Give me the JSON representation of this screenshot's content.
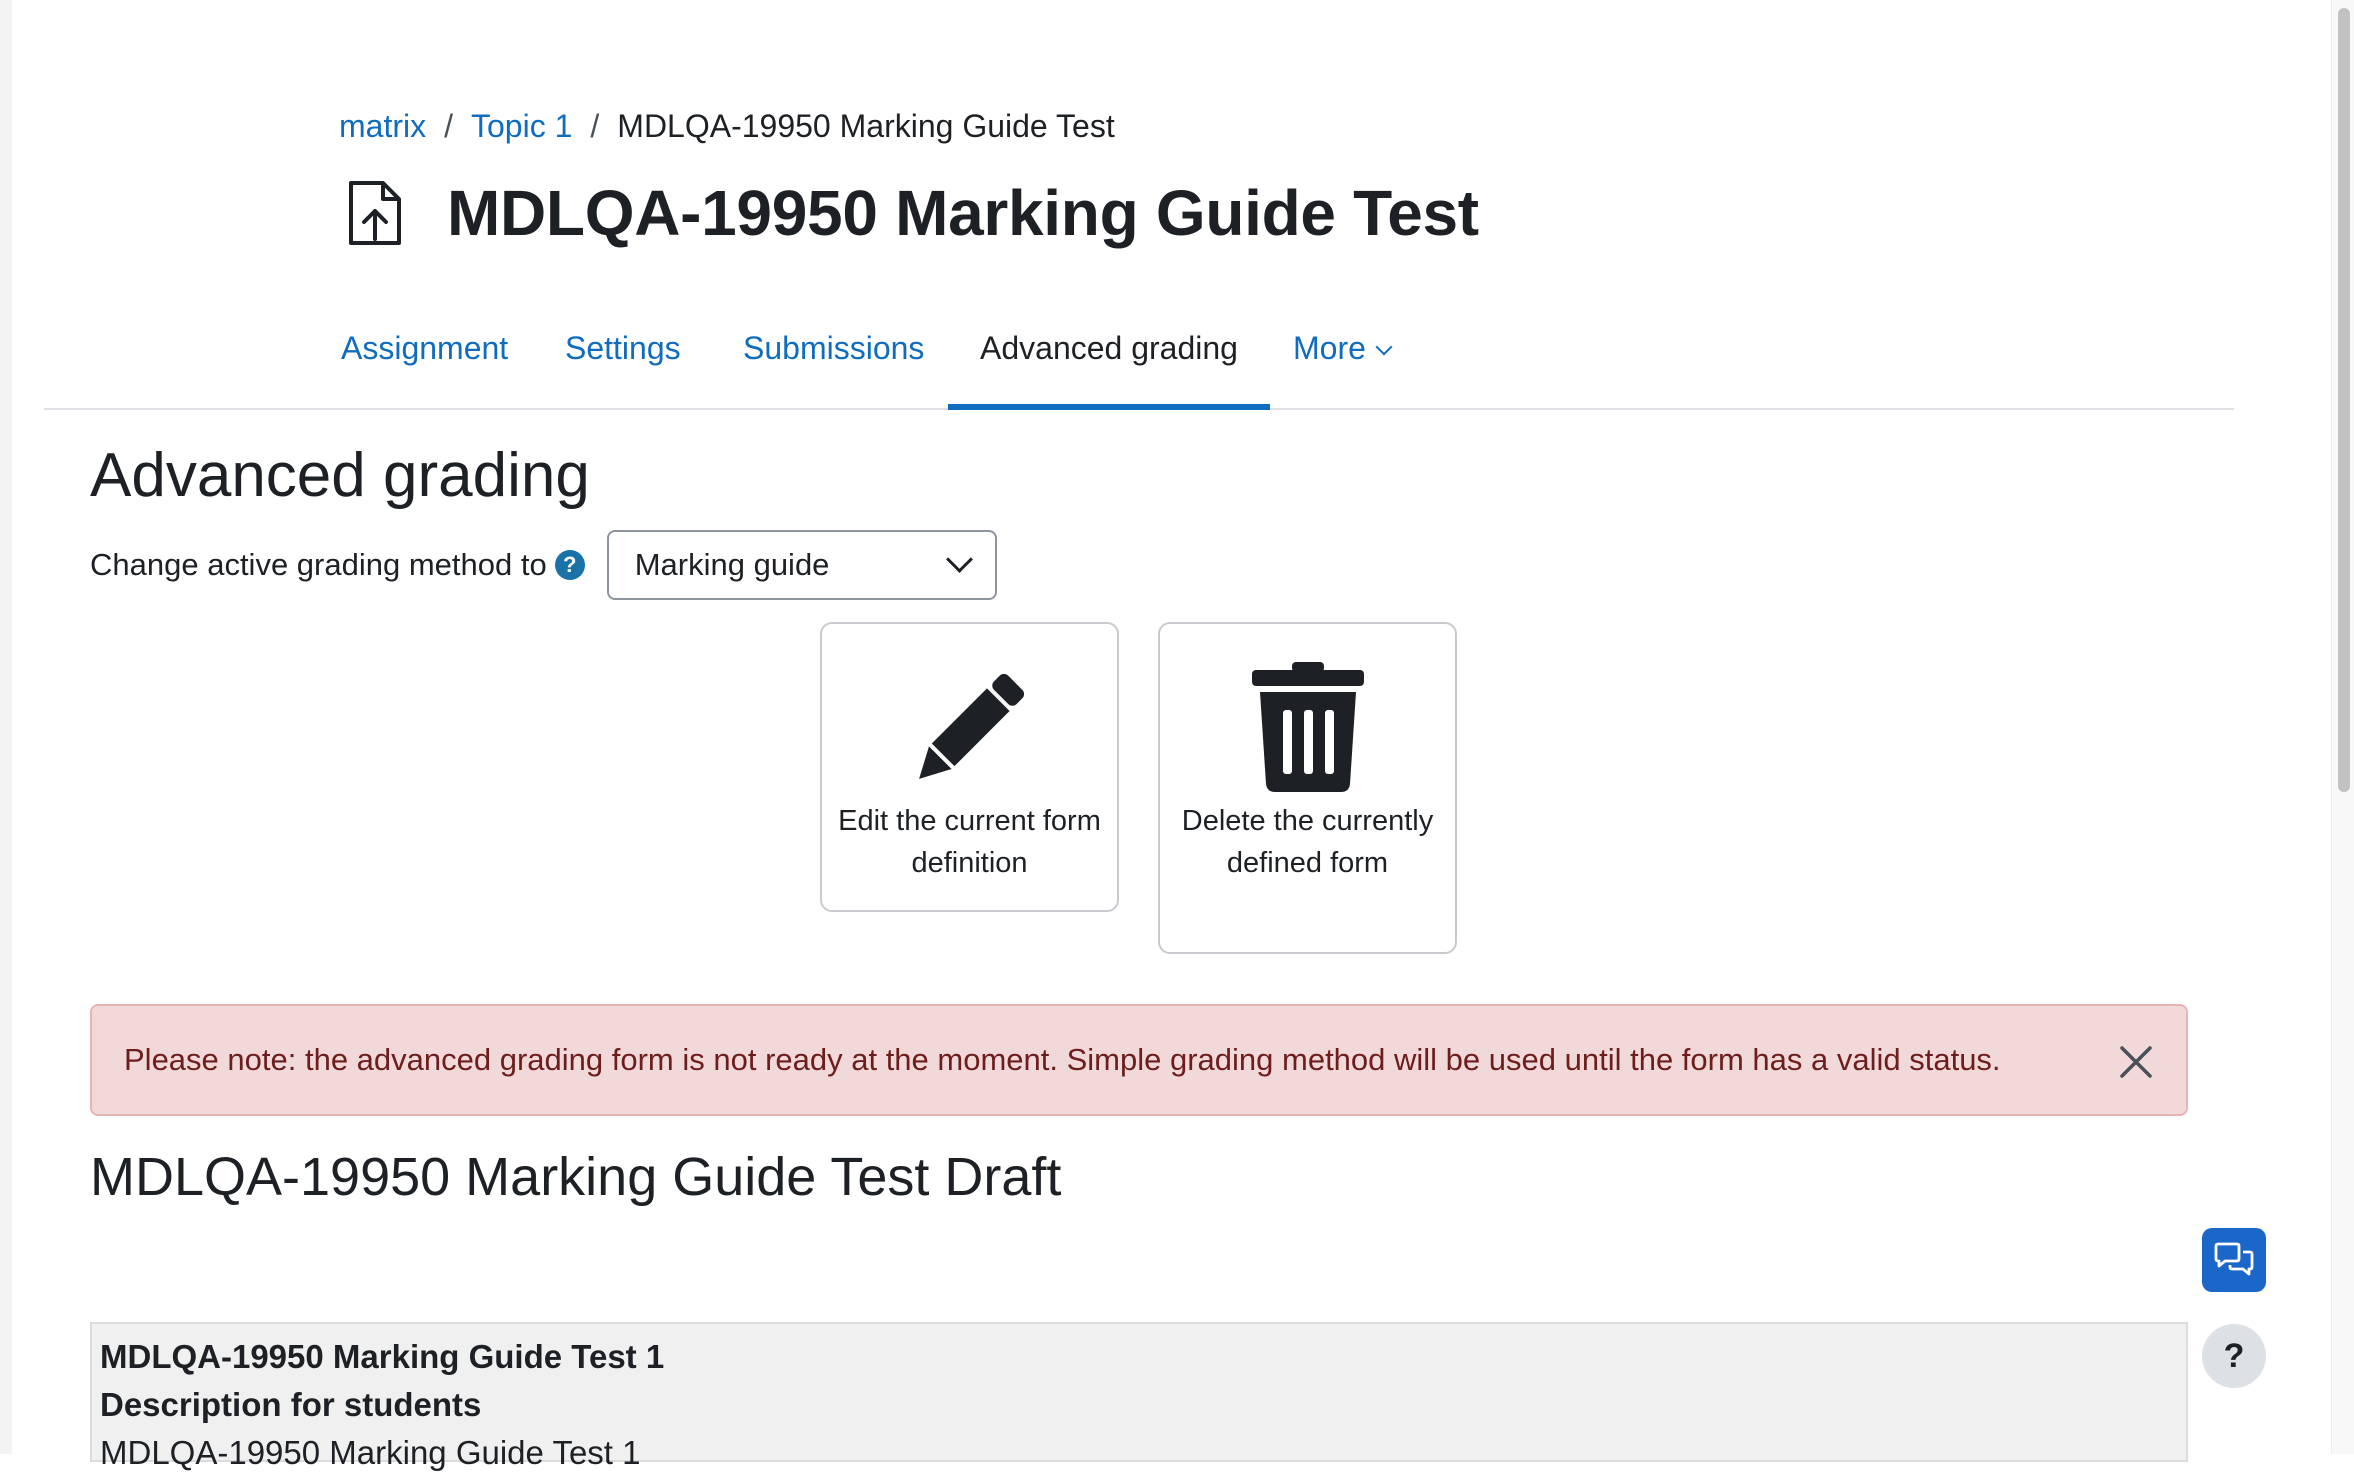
{
  "breadcrumb": {
    "items": [
      "matrix",
      "Topic 1"
    ],
    "current": "MDLQA-19950 Marking Guide Test",
    "separator": "/"
  },
  "page": {
    "title": "MDLQA-19950 Marking Guide Test",
    "icon": "file-upload-icon"
  },
  "tabs": [
    {
      "label": "Assignment"
    },
    {
      "label": "Settings"
    },
    {
      "label": "Submissions"
    },
    {
      "label": "Advanced grading",
      "active": true
    },
    {
      "label": "More"
    }
  ],
  "section": {
    "heading": "Advanced grading",
    "method_label": "Change active grading method to",
    "help_icon_glyph": "?",
    "method_selected": "Marking guide"
  },
  "actions": {
    "edit_label": "Edit the current form definition",
    "delete_label": "Delete the currently defined form",
    "edit_icon": "pencil-icon",
    "delete_icon": "trash-icon"
  },
  "alert": {
    "text": "Please note: the advanced grading form is not ready at the moment. Simple grading method will be used until the form has a valid status."
  },
  "form": {
    "heading": "MDLQA-19950 Marking Guide Test Draft",
    "criterion": {
      "title": "MDLQA-19950 Marking Guide Test 1",
      "description_label": "Description for students",
      "description": "MDLQA-19950 Marking Guide Test 1"
    }
  },
  "floating": {
    "chat_icon": "chat-bubbles-icon",
    "help_glyph": "?"
  },
  "colors": {
    "link": "#0f6cbf",
    "alert_bg": "#f1d9d9",
    "alert_text": "#6e1d1d",
    "chat_button": "#1b66c9"
  }
}
